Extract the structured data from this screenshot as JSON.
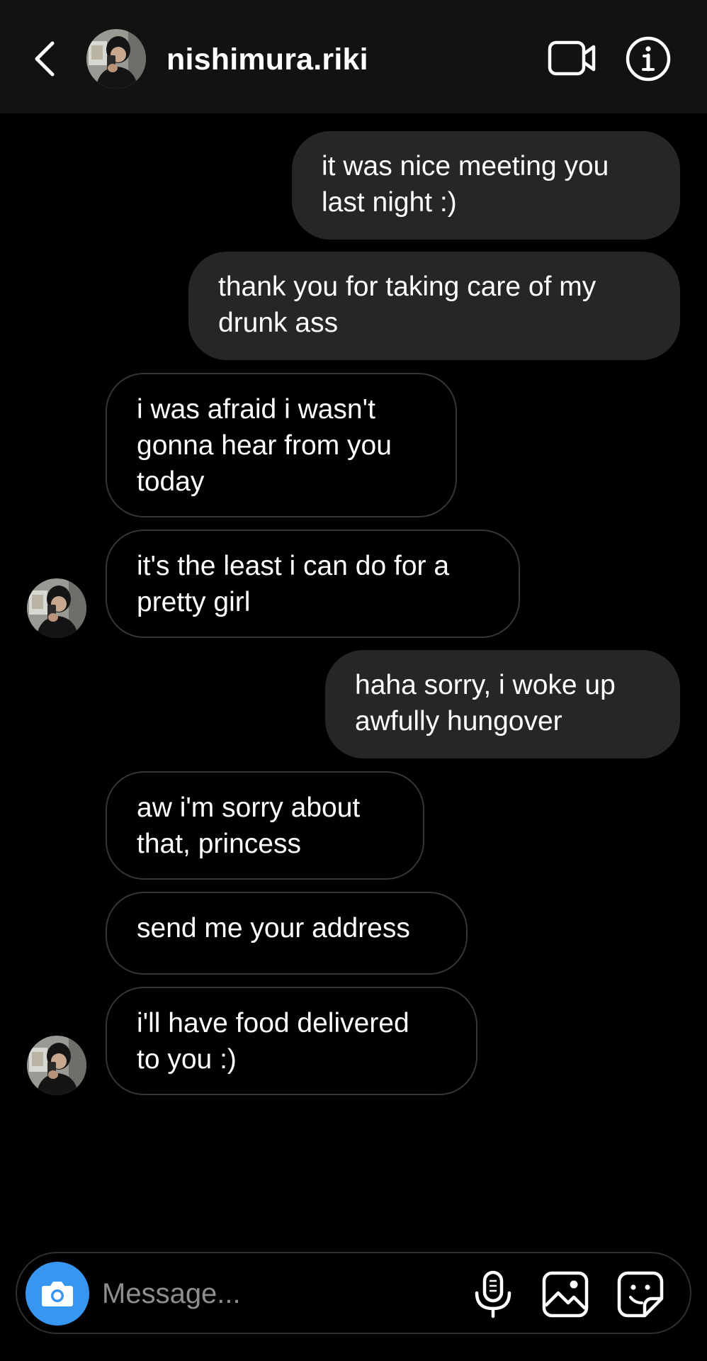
{
  "header": {
    "username": "nishimura.riki"
  },
  "messages": [
    {
      "direction": "out",
      "text": "it was nice meeting you\nlast night :)"
    },
    {
      "direction": "out",
      "text": "thank you for taking care of my\ndrunk ass"
    },
    {
      "direction": "in",
      "text": "i was afraid i wasn't\ngonna hear from you\ntoday"
    },
    {
      "direction": "in",
      "text": "it's the least i can do for a\npretty girl"
    },
    {
      "direction": "out",
      "text": "haha sorry, i woke up\nawfully hungover"
    },
    {
      "direction": "in",
      "text": "aw i'm sorry about\nthat, princess"
    },
    {
      "direction": "in",
      "text": "send me your address"
    },
    {
      "direction": "in",
      "text": "i'll have food delivered\nto you :)"
    }
  ],
  "composer": {
    "placeholder": "Message..."
  },
  "icons": {
    "back": "chevron-left-icon",
    "video": "video-camera-icon",
    "info": "info-icon",
    "camera": "camera-icon",
    "mic": "microphone-icon",
    "gallery": "image-icon",
    "sticker": "sticker-icon"
  },
  "colors": {
    "background": "#000000",
    "header": "#121212",
    "outgoing_bubble": "#262626",
    "incoming_border": "#363636",
    "camera_button": "#3797f0",
    "placeholder": "#8e8e8e"
  }
}
